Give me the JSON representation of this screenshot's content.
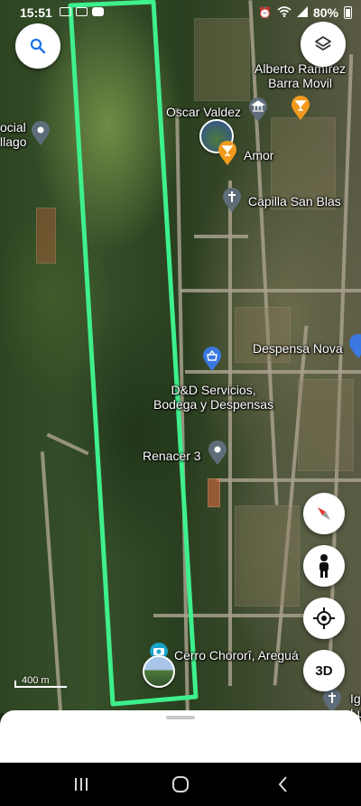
{
  "status_bar": {
    "time": "15:51",
    "battery": "80%"
  },
  "map": {
    "scale_label": "400 m",
    "places": [
      {
        "name": "Alberto Ramírez\nBarra Movil",
        "id": "alberto"
      },
      {
        "name": "Oscar Valdez",
        "id": "oscar"
      },
      {
        "name": "Amor",
        "id": "amor"
      },
      {
        "name": "Capilla San Blas",
        "id": "capilla"
      },
      {
        "name": "Despensa Nova",
        "id": "despensa"
      },
      {
        "name": "D&D Servicios,\nBodega y Despensas",
        "id": "dd"
      },
      {
        "name": "Renacer 3",
        "id": "renacer"
      },
      {
        "name": "Cerro Chororî, Areguá",
        "id": "cerro"
      },
      {
        "name": "ocial\nllago",
        "id": "left-cut"
      },
      {
        "name": "Ig\nLu",
        "id": "right-cut"
      }
    ]
  },
  "controls": {
    "threed_label": "3D"
  },
  "colors": {
    "highlight": "#3ef08c",
    "pin_blue": "#3a78e0",
    "pin_orange": "#f29a1c",
    "pin_gray": "#5f6d7a"
  },
  "icons": [
    "search-icon",
    "layers-icon",
    "compass-icon",
    "pegman-icon",
    "my-location-icon",
    "camera-icon"
  ]
}
